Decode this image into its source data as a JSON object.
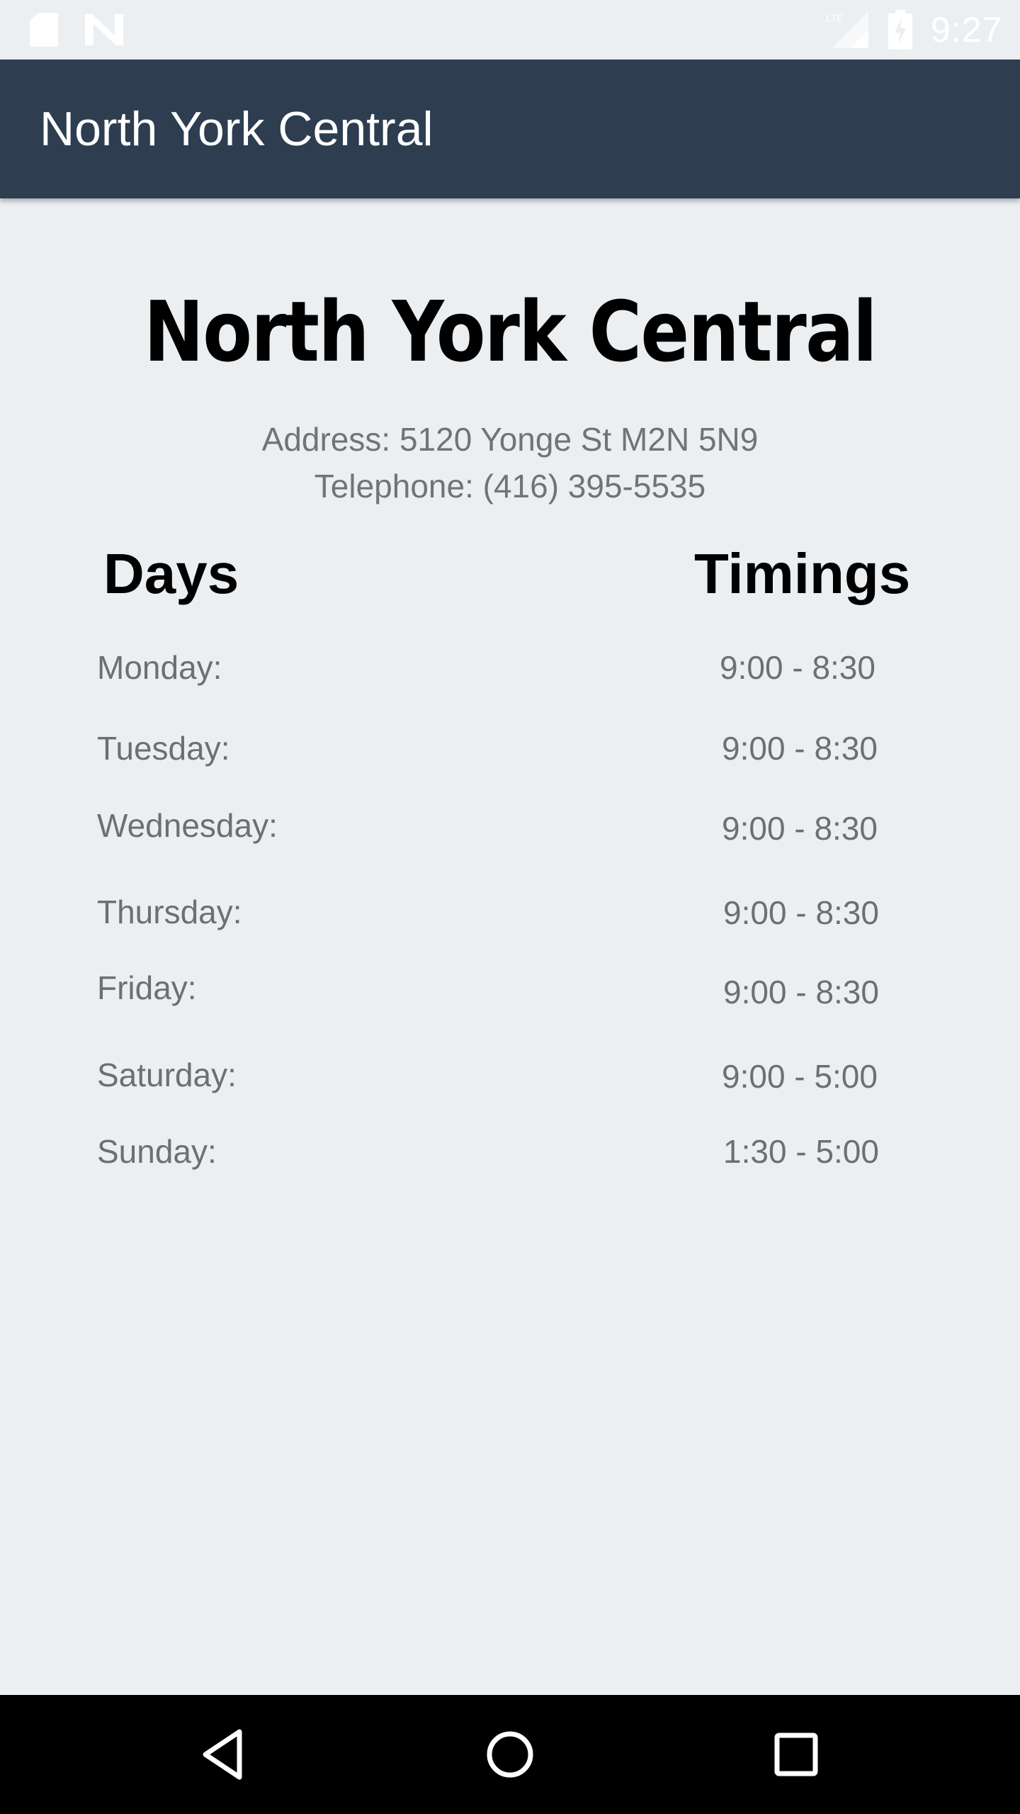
{
  "status_bar": {
    "time": "9:27",
    "network": "LTE",
    "icons": [
      "sd-card-icon",
      "n-notification-icon",
      "lte-signal-icon",
      "battery-charging-icon"
    ]
  },
  "app_bar": {
    "title": "North York Central"
  },
  "main": {
    "heading": "North York Central",
    "address": "Address: 5120 Yonge St M2N 5N9",
    "telephone": "Telephone: (416) 395-5535",
    "days_header": "Days",
    "timings_header": "Timings",
    "schedule": [
      {
        "day": "Monday:",
        "time": "9:00 - 8:30"
      },
      {
        "day": "Tuesday:",
        "time": "9:00 - 8:30"
      },
      {
        "day": "Wednesday:",
        "time": "9:00 - 8:30"
      },
      {
        "day": "Thursday:",
        "time": "9:00 - 8:30"
      },
      {
        "day": "Friday:",
        "time": "9:00 - 8:30"
      },
      {
        "day": "Saturday:",
        "time": "9:00 - 5:00"
      },
      {
        "day": "Sunday:",
        "time": "1:30 - 5:00"
      }
    ]
  },
  "nav_bar": {
    "buttons": [
      "back-icon",
      "home-icon",
      "recents-icon"
    ]
  },
  "colors": {
    "app_bar": "#2e3d50",
    "background": "#eceff1",
    "nav_bar": "#000000",
    "secondary_text": "#6f6f6f"
  }
}
